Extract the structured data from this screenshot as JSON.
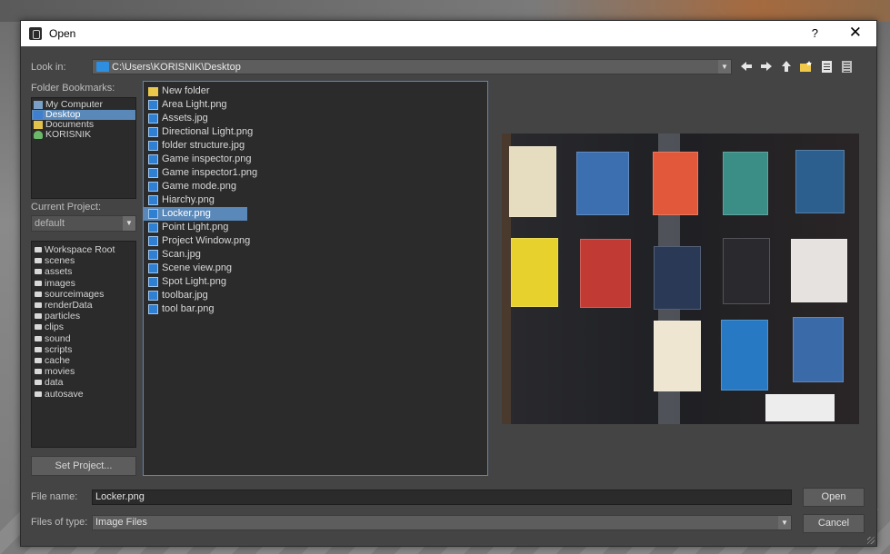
{
  "window": {
    "title": "Open",
    "help": "?",
    "close": "✕"
  },
  "lookin": {
    "label": "Look in:",
    "path": "C:\\Users\\KORISNIK\\Desktop"
  },
  "toolbar": {
    "icons": [
      "back-icon",
      "forward-icon",
      "up-folder-icon",
      "new-folder-icon",
      "list-view-icon",
      "detail-view-icon"
    ]
  },
  "bookmarks": {
    "label": "Folder Bookmarks:",
    "items": [
      "My Computer",
      "Desktop",
      "Documents",
      "KORISNIK"
    ],
    "selected": "Desktop"
  },
  "project": {
    "label": "Current Project:",
    "value": "default",
    "tree": [
      "Workspace Root",
      "scenes",
      "assets",
      "images",
      "sourceimages",
      "renderData",
      "particles",
      "clips",
      "sound",
      "scripts",
      "cache",
      "movies",
      "data",
      "autosave"
    ],
    "set_button": "Set Project..."
  },
  "files": {
    "items": [
      "New folder",
      "Area Light.png",
      "Assets.jpg",
      "Directional Light.png",
      "folder structure.jpg",
      "Game inspector.png",
      "Game inspector1.png",
      "Game mode.png",
      "Hiarchy.png",
      "Locker.png",
      "Point Light.png",
      "Project Window.png",
      "Scan.jpg",
      "Scene view.png",
      "Spot Light.png",
      "toolbar.jpg",
      "tool bar.png"
    ],
    "selected": "Locker.png"
  },
  "footer": {
    "filename_label": "File name:",
    "filename_value": "Locker.png",
    "filetype_label": "Files of type:",
    "filetype_value": "Image Files",
    "open_button": "Open",
    "cancel_button": "Cancel"
  },
  "colors": {
    "dialog_bg": "#444444",
    "list_bg": "#2b2b2b",
    "selection": "#5a88b8",
    "folder_icon": "#e9c84b",
    "file_icon": "#2f7fd2"
  }
}
